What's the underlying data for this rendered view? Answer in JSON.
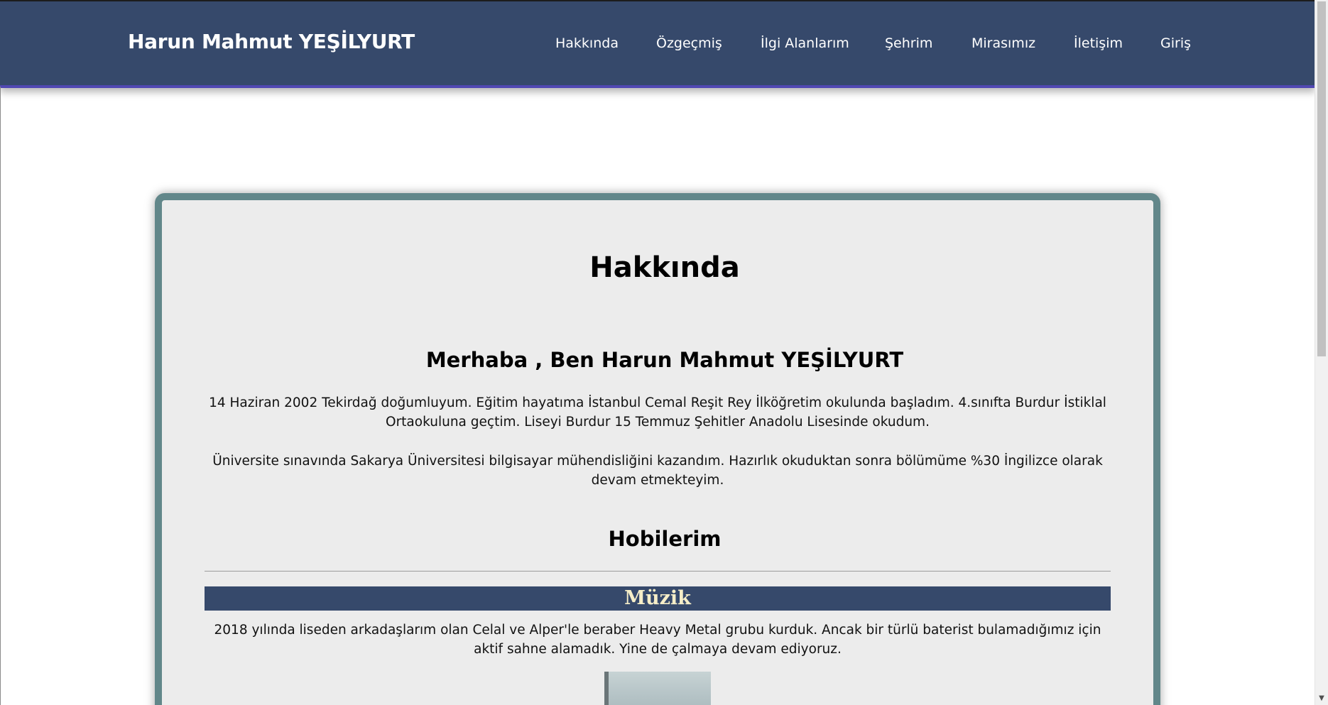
{
  "header": {
    "brand": "Harun Mahmut YEŞİLYURT",
    "nav": [
      "Hakkında",
      "Özgeçmiş",
      "İlgi Alanlarım",
      "Şehrim",
      "Mirasımız",
      "İletişim",
      "Giriş"
    ]
  },
  "main": {
    "title": "Hakkında",
    "greeting": "Merhaba , Ben Harun Mahmut YEŞİLYURT",
    "paragraph1": "14 Haziran 2002 Tekirdağ doğumluyum. Eğitim hayatıma İstanbul Cemal Reşit Rey İlköğretim okulunda başladım. 4.sınıfta Burdur İstiklal Ortaokuluna geçtim. Liseyi Burdur 15 Temmuz Şehitler Anadolu Lisesinde okudum.",
    "paragraph2": "Üniversite sınavında Sakarya Üniversitesi bilgisayar mühendisliğini kazandım. Hazırlık okuduktan sonra bölümüme %30 İngilizce olarak devam etmekteyim.",
    "hobbies_title": "Hobilerim",
    "music_title": "Müzik",
    "music_text": "2018 yılında liseden arkadaşlarım olan Celal ve Alper'le beraber Heavy Metal grubu kurduk. Ancak bir türlü baterist bulamadığımız için aktif sahne alamadık. Yine de çalmaya devam ediyoruz."
  },
  "colors": {
    "navbar": "#36496b",
    "card_border": "#62878a",
    "card_background": "#ececec",
    "music_title_text": "#f6eec8"
  },
  "icons": {
    "scroll_down": "chevron-down-icon"
  }
}
